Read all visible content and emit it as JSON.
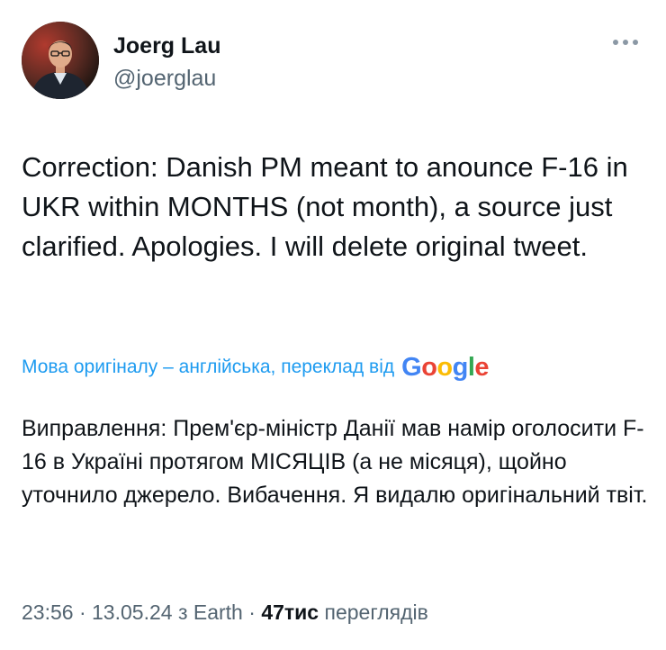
{
  "author": {
    "name": "Joerg Lau",
    "handle": "@joerglau"
  },
  "tweet": {
    "text": "Correction: Danish PM meant to anounce F-16 in UKR within MONTHS (not month), a source just clarified. Apologies. I will delete original tweet."
  },
  "translation": {
    "label": "Мова оригіналу – англійська, переклад від",
    "provider_letters": [
      {
        "ch": "G",
        "color": "#4285F4"
      },
      {
        "ch": "o",
        "color": "#EA4335"
      },
      {
        "ch": "o",
        "color": "#FBBC05"
      },
      {
        "ch": "g",
        "color": "#4285F4"
      },
      {
        "ch": "l",
        "color": "#34A853"
      },
      {
        "ch": "e",
        "color": "#EA4335"
      }
    ],
    "text": "Виправлення: Прем'єр-міністр Данії мав намір оголосити F-16 в Україні протягом МІСЯЦІВ (а не місяця), щойно уточнило джерело. Вибачення. Я видалю оригінальний твіт."
  },
  "meta": {
    "time": "23:56",
    "sep1": "·",
    "date": "13.05.24",
    "source": "з Earth",
    "sep2": "·",
    "views_count": "47тис",
    "views_label": "переглядів"
  },
  "icons": {
    "more": "more-horizontal-icon"
  },
  "colors": {
    "link": "#1d9bf0",
    "muted": "#536471",
    "text": "#0f1419"
  }
}
